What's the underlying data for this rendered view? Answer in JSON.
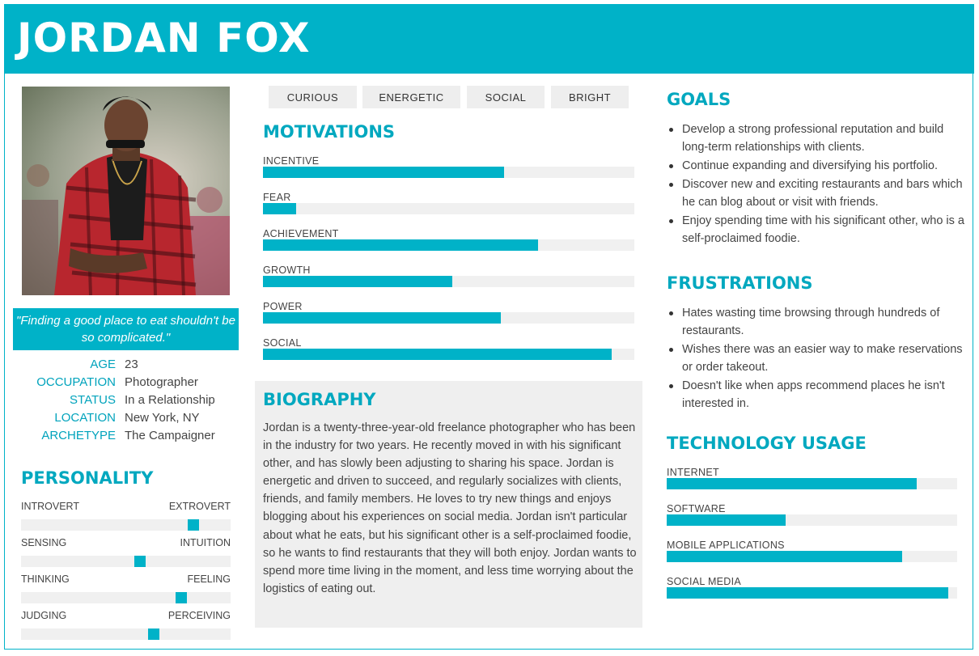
{
  "persona": {
    "name": "JORDAN FOX",
    "quote": "\"Finding a good place to eat shouldn't be so complicated.\"",
    "facts": [
      {
        "key": "AGE",
        "value": "23"
      },
      {
        "key": "OCCUPATION",
        "value": "Photographer"
      },
      {
        "key": "STATUS",
        "value": "In a Relationship"
      },
      {
        "key": "LOCATION",
        "value": "New York, NY"
      },
      {
        "key": "ARCHETYPE",
        "value": "The Campaigner"
      }
    ]
  },
  "personality": {
    "title": "PERSONALITY",
    "scales": [
      {
        "left": "INTROVERT",
        "right": "EXTROVERT",
        "value": 0.84
      },
      {
        "left": "SENSING",
        "right": "INTUITION",
        "value": 0.57
      },
      {
        "left": "THINKING",
        "right": "FEELING",
        "value": 0.78
      },
      {
        "left": "JUDGING",
        "right": "PERCEIVING",
        "value": 0.64
      }
    ]
  },
  "traits": [
    "CURIOUS",
    "ENERGETIC",
    "SOCIAL",
    "BRIGHT"
  ],
  "motivations": {
    "title": "MOTIVATIONS",
    "items": [
      {
        "label": "INCENTIVE",
        "value": 0.65
      },
      {
        "label": "FEAR",
        "value": 0.09
      },
      {
        "label": "ACHIEVEMENT",
        "value": 0.74
      },
      {
        "label": "GROWTH",
        "value": 0.51
      },
      {
        "label": "POWER",
        "value": 0.64
      },
      {
        "label": "SOCIAL",
        "value": 0.94
      }
    ]
  },
  "biography": {
    "title": "BIOGRAPHY",
    "text": "Jordan is a twenty-three-year-old freelance photographer who has been in the industry for two years. He recently moved in with his significant other, and has slowly been adjusting to sharing his space. Jordan is energetic and driven to succeed, and regularly socializes with clients, friends, and family members. He loves to try new things and enjoys blogging about his experiences on social media. Jordan isn't particular about what he eats, but his significant other is a self-proclaimed foodie, so he wants to find restaurants that they will both enjoy. Jordan wants to spend more time living in the moment, and less time worrying about the logistics of eating out."
  },
  "goals": {
    "title": "GOALS",
    "items": [
      "Develop a strong professional reputation and build long-term relationships with clients.",
      "Continue expanding and diversifying his portfolio.",
      "Discover new and exciting restaurants and bars which he can blog about or visit with friends.",
      "Enjoy spending time with his significant other, who is a self-proclaimed foodie."
    ]
  },
  "frustrations": {
    "title": "FRUSTRATIONS",
    "items": [
      "Hates wasting time browsing through hundreds of restaurants.",
      "Wishes there was an easier way to make reservations or order takeout.",
      "Doesn't like when apps recommend places he isn't interested in."
    ]
  },
  "technology": {
    "title": "TECHNOLOGY USAGE",
    "items": [
      {
        "label": "INTERNET",
        "value": 0.86
      },
      {
        "label": "SOFTWARE",
        "value": 0.41
      },
      {
        "label": "MOBILE APPLICATIONS",
        "value": 0.81
      },
      {
        "label": "SOCIAL MEDIA",
        "value": 0.97
      }
    ]
  },
  "colors": {
    "accent": "#00b2c8",
    "panel": "#efefef",
    "track": "#f0f0f0"
  }
}
